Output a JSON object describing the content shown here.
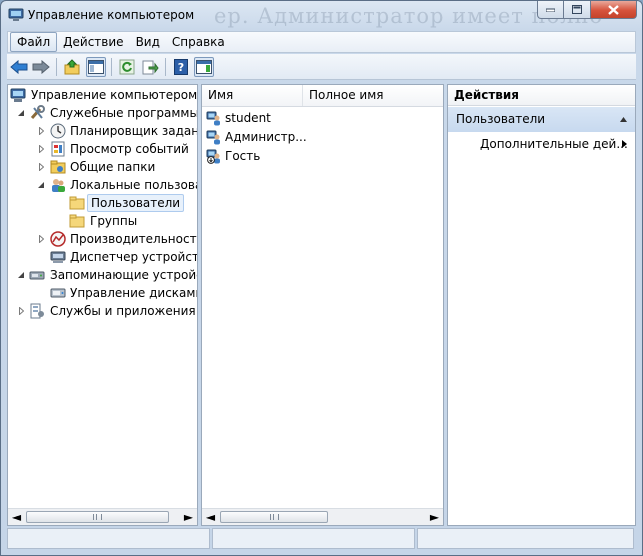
{
  "window": {
    "title": "Управление компьютером",
    "background_overlay_text": "ер. Администратор имеет полно"
  },
  "menu": {
    "file": "Файл",
    "action": "Действие",
    "view": "Вид",
    "help": "Справка"
  },
  "toolbar": {
    "icons": [
      "back-arrow-icon",
      "forward-arrow-icon",
      "up-folder-icon",
      "show-hide-console-tree-icon",
      "refresh-icon",
      "export-list-icon",
      "help-icon",
      "show-hide-action-pane-icon"
    ]
  },
  "tree": {
    "root": "Управление компьютером (л",
    "system_tools": "Служебные программы",
    "task_scheduler": "Планировщик заданий",
    "event_viewer": "Просмотр событий",
    "shared_folders": "Общие папки",
    "local_users": "Локальные пользовате",
    "users": "Пользователи",
    "groups": "Группы",
    "performance": "Производительность",
    "device_manager": "Диспетчер устройств",
    "storage": "Запоминающие устройст",
    "disk_management": "Управление дисками",
    "services_apps": "Службы и приложения",
    "scroll_left": "◄",
    "scroll_right": "►"
  },
  "list": {
    "col_name": "Имя",
    "col_fullname": "Полное имя",
    "rows": [
      {
        "name": "student",
        "fullname": ""
      },
      {
        "name": "Администр...",
        "fullname": ""
      },
      {
        "name": "Гость",
        "fullname": ""
      }
    ]
  },
  "actions": {
    "header": "Действия",
    "section": "Пользователи",
    "more": "Дополнительные дей..."
  },
  "colors": {
    "selection_bg": "#e8f1fb",
    "action_section_bg": "#c7d9ef",
    "close_button": "#d6533c"
  }
}
